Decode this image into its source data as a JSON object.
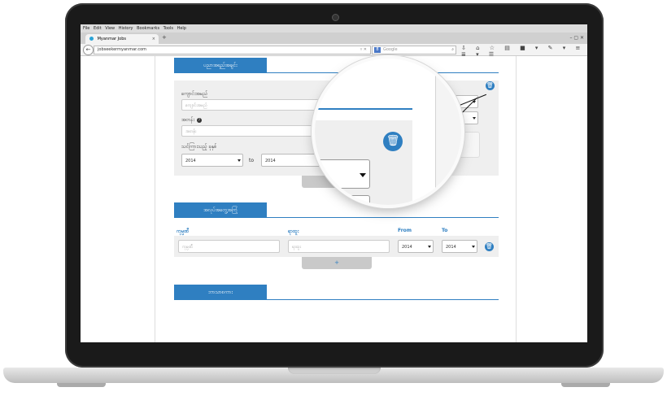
{
  "browser": {
    "menu": [
      "File",
      "Edit",
      "View",
      "History",
      "Bookmarks",
      "Tools",
      "Help"
    ],
    "tab_title": "Myanmar Jobs",
    "tab_close": "×",
    "new_tab": "+",
    "window_buttons": "– ▢ ✕",
    "url": "jobseekermyanmar.com",
    "url_controls": "▿ ✕",
    "search_placeholder": "Google",
    "search_engine": "8",
    "back": "←",
    "search_icon": "⌕",
    "toolbar_icons": "⇩ ⌂ ☆ ▤ ■ ▾ ✎ ▾ ≡ ≣ ▾ ☰"
  },
  "page": {
    "section1": {
      "title": "ပညာအရည်အချင်း",
      "degree_label": "ကျောင်းအမည်",
      "degree_placeholder": "ကျောင်းအမည်",
      "subject_label": "အတန်း",
      "subject_placeholder": "အတန်း",
      "help": "?",
      "date_label": "သင်ကြားသည့် ခုနှစ်",
      "from_year": "2014",
      "to_text": "to",
      "to_year": "2014"
    },
    "section2": {
      "title": "အလုပ်အတွေ့အကြုံ",
      "col_company": "ကုမ္ပဏီ",
      "col_position": "ရာထူး",
      "col_from": "From",
      "col_to": "To",
      "company_placeholder": "ကုမ္ပဏီ",
      "position_placeholder": "ရာထူး",
      "from_year": "2014",
      "to_year": "2014",
      "add": "+"
    },
    "section3": {
      "title": "ဘာသာစကား"
    },
    "trash_icon": "🗑"
  },
  "colors": {
    "accent": "#2f7fc1",
    "panel": "#efefef"
  }
}
